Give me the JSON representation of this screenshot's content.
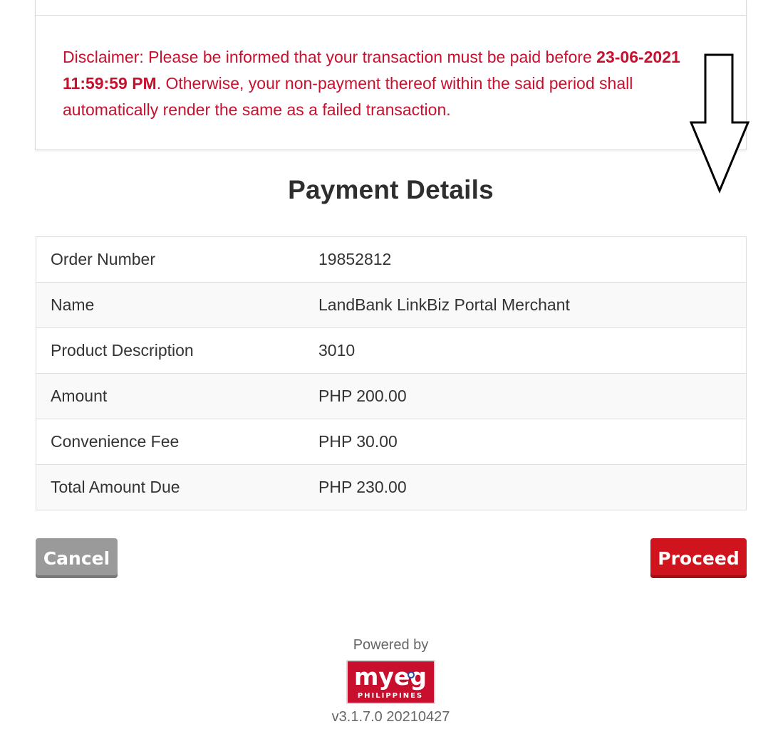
{
  "disclaimer": {
    "prefix": "Disclaimer: Please be informed that your transaction must be paid before ",
    "deadline": "23-06-2021 11:59:59 PM",
    "suffix": ". Otherwise, your non-payment thereof within the said period shall automatically render the same as a failed transaction."
  },
  "payment_details": {
    "title": "Payment Details",
    "rows": [
      {
        "label": "Order Number",
        "value": "19852812"
      },
      {
        "label": "Name",
        "value": "LandBank LinkBiz Portal Merchant"
      },
      {
        "label": "Product Description",
        "value": "3010"
      },
      {
        "label": "Amount",
        "value": "PHP 200.00"
      },
      {
        "label": "Convenience Fee",
        "value": "PHP 30.00"
      },
      {
        "label": "Total Amount Due",
        "value": "PHP 230.00"
      }
    ]
  },
  "buttons": {
    "cancel_label": "Cancel",
    "proceed_label": "Proceed"
  },
  "footer": {
    "powered_by": "Powered by",
    "logo_text": "myeg",
    "logo_subtext": "PHILIPPINES",
    "version": "v3.1.7.0 20210427"
  },
  "colors": {
    "disclaimer_red": "#c8102e",
    "proceed_red": "#d0141d",
    "cancel_gray": "#9a9a9a"
  }
}
